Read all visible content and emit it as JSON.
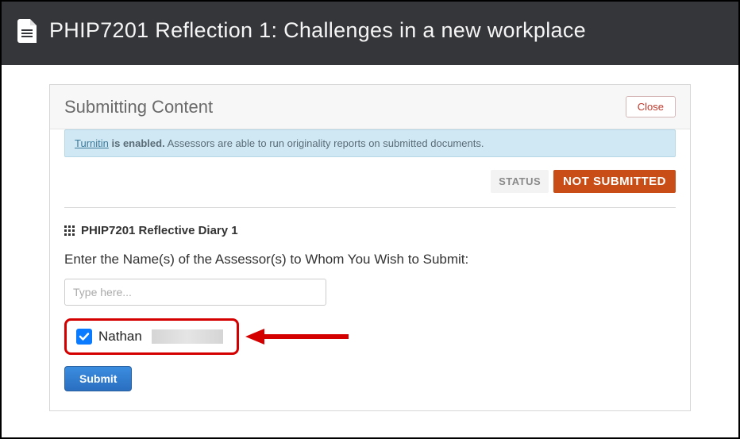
{
  "header": {
    "title": "PHIP7201 Reflection 1: Challenges in a new workplace"
  },
  "panel": {
    "title": "Submitting Content",
    "close_label": "Close"
  },
  "info": {
    "link_text": "Turnitin",
    "bold_text": " is enabled.",
    "rest": " Assessors are able to run originality reports on submitted documents."
  },
  "status": {
    "label": "STATUS",
    "value": "NOT SUBMITTED"
  },
  "section": {
    "title": "PHIP7201 Reflective Diary 1",
    "prompt": "Enter the Name(s) of the Assessor(s) to Whom You Wish to Submit:",
    "input_placeholder": "Type here..."
  },
  "selected_assessor": {
    "checked": true,
    "name": "Nathan"
  },
  "submit": {
    "label": "Submit"
  }
}
